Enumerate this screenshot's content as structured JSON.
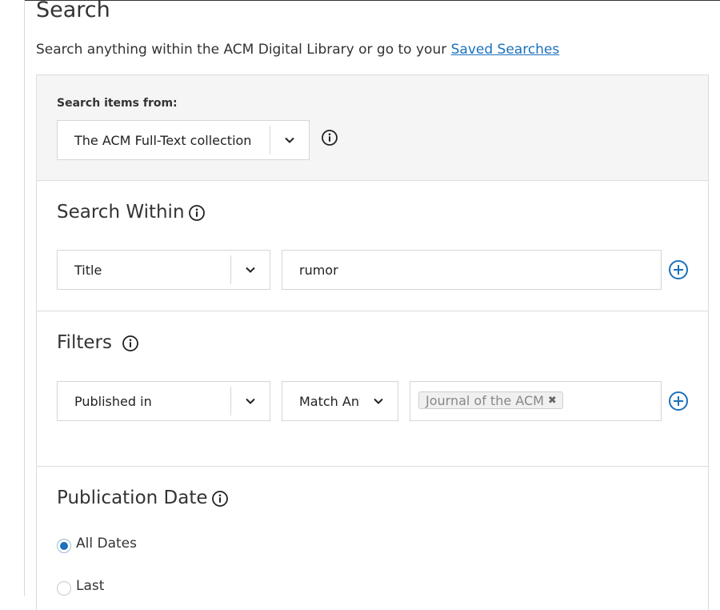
{
  "page": {
    "title": "Search",
    "intro_text": "Search anything within the ACM Digital Library or go to your ",
    "saved_searches_link": "Saved Searches"
  },
  "collection": {
    "label": "Search items from:",
    "selected": "The ACM Full-Text collection"
  },
  "search_within": {
    "title": "Search Within",
    "field_selected": "Title",
    "query_value": "rumor"
  },
  "filters": {
    "title": "Filters",
    "field_selected": "Published in",
    "match_selected": "Match Any",
    "chips": [
      {
        "label": "Journal of the ACM",
        "remove": "✖"
      }
    ]
  },
  "publication_date": {
    "title": "Publication Date",
    "options": [
      {
        "label": "All Dates",
        "checked": true
      },
      {
        "label": "Last",
        "checked": false
      }
    ]
  },
  "colors": {
    "accent": "#1a71bd",
    "panel_gray": "#f5f5f5",
    "border": "#dcdcdc",
    "text": "#333333"
  },
  "icons": {
    "info": "info-icon",
    "chevron": "chevron-down-icon",
    "add": "plus-circle-icon",
    "remove": "close-icon"
  }
}
